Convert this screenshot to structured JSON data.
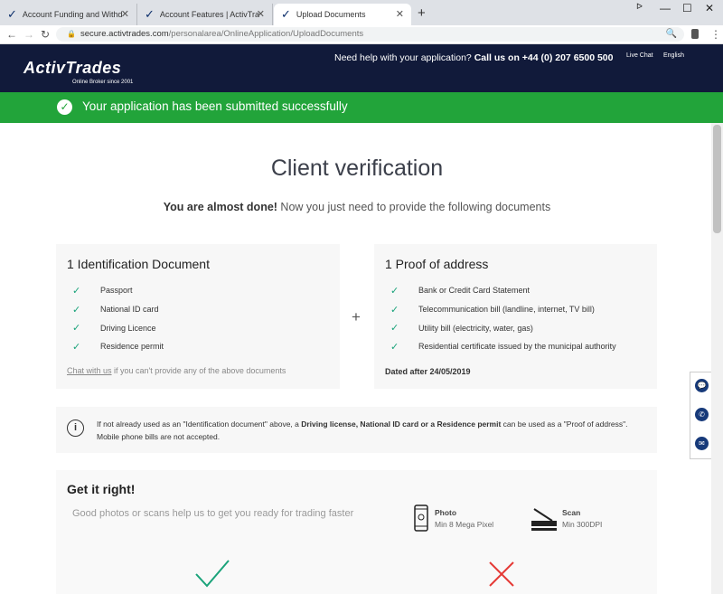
{
  "browser": {
    "tabs": [
      {
        "title": "Account Funding and Withdrawal"
      },
      {
        "title": "Account Features | ActivTrades"
      },
      {
        "title": "Upload Documents"
      }
    ],
    "url_domain": "secure.activtrades.com",
    "url_path": "/personalarea/OnlineApplication/UploadDocuments"
  },
  "header": {
    "logo": "ActivTrades",
    "logo_tagline": "Online Broker since 2001",
    "help_prefix": "Need help with your application?",
    "help_phone": "Call us on +44 (0) 207 6500 500",
    "live_chat": "Live Chat",
    "language": "English"
  },
  "banner": {
    "text": "Your application has been submitted successfully"
  },
  "main": {
    "title": "Client verification",
    "subtitle_bold": "You are almost done!",
    "subtitle_rest": " Now you just need to provide the following documents"
  },
  "id_card": {
    "title": "1 Identification Document",
    "items": [
      "Passport",
      "National ID card",
      "Driving Licence",
      "Residence permit"
    ],
    "chat_link": "Chat with us",
    "chat_rest": " if you can't provide any of the above documents"
  },
  "address_card": {
    "title": "1 Proof of address",
    "items": [
      "Bank or Credit Card Statement",
      "Telecommunication bill (landline, internet, TV bill)",
      "Utility bill (electricity, water, gas)",
      "Residential certificate issued by the municipal authority"
    ],
    "dated": "Dated after 24/05/2019"
  },
  "info": {
    "part1": "If not already used as an \"Identification document\" above, a ",
    "bold": "Driving license, National ID card or a Residence permit",
    "part2": " can be used as a \"Proof of address\". Mobile phone bills are not accepted."
  },
  "get_it_right": {
    "title": "Get it right!",
    "subtitle": "Good photos or scans help us to get you ready for trading faster",
    "photo_label": "Photo",
    "photo_value": "Min 8 Mega Pixel",
    "scan_label": "Scan",
    "scan_value": "Min 300DPI"
  },
  "colors": {
    "header_bg": "#111a3a",
    "success_green": "#22a43a",
    "check_green": "#1aa37a",
    "bad_red": "#e53935"
  }
}
